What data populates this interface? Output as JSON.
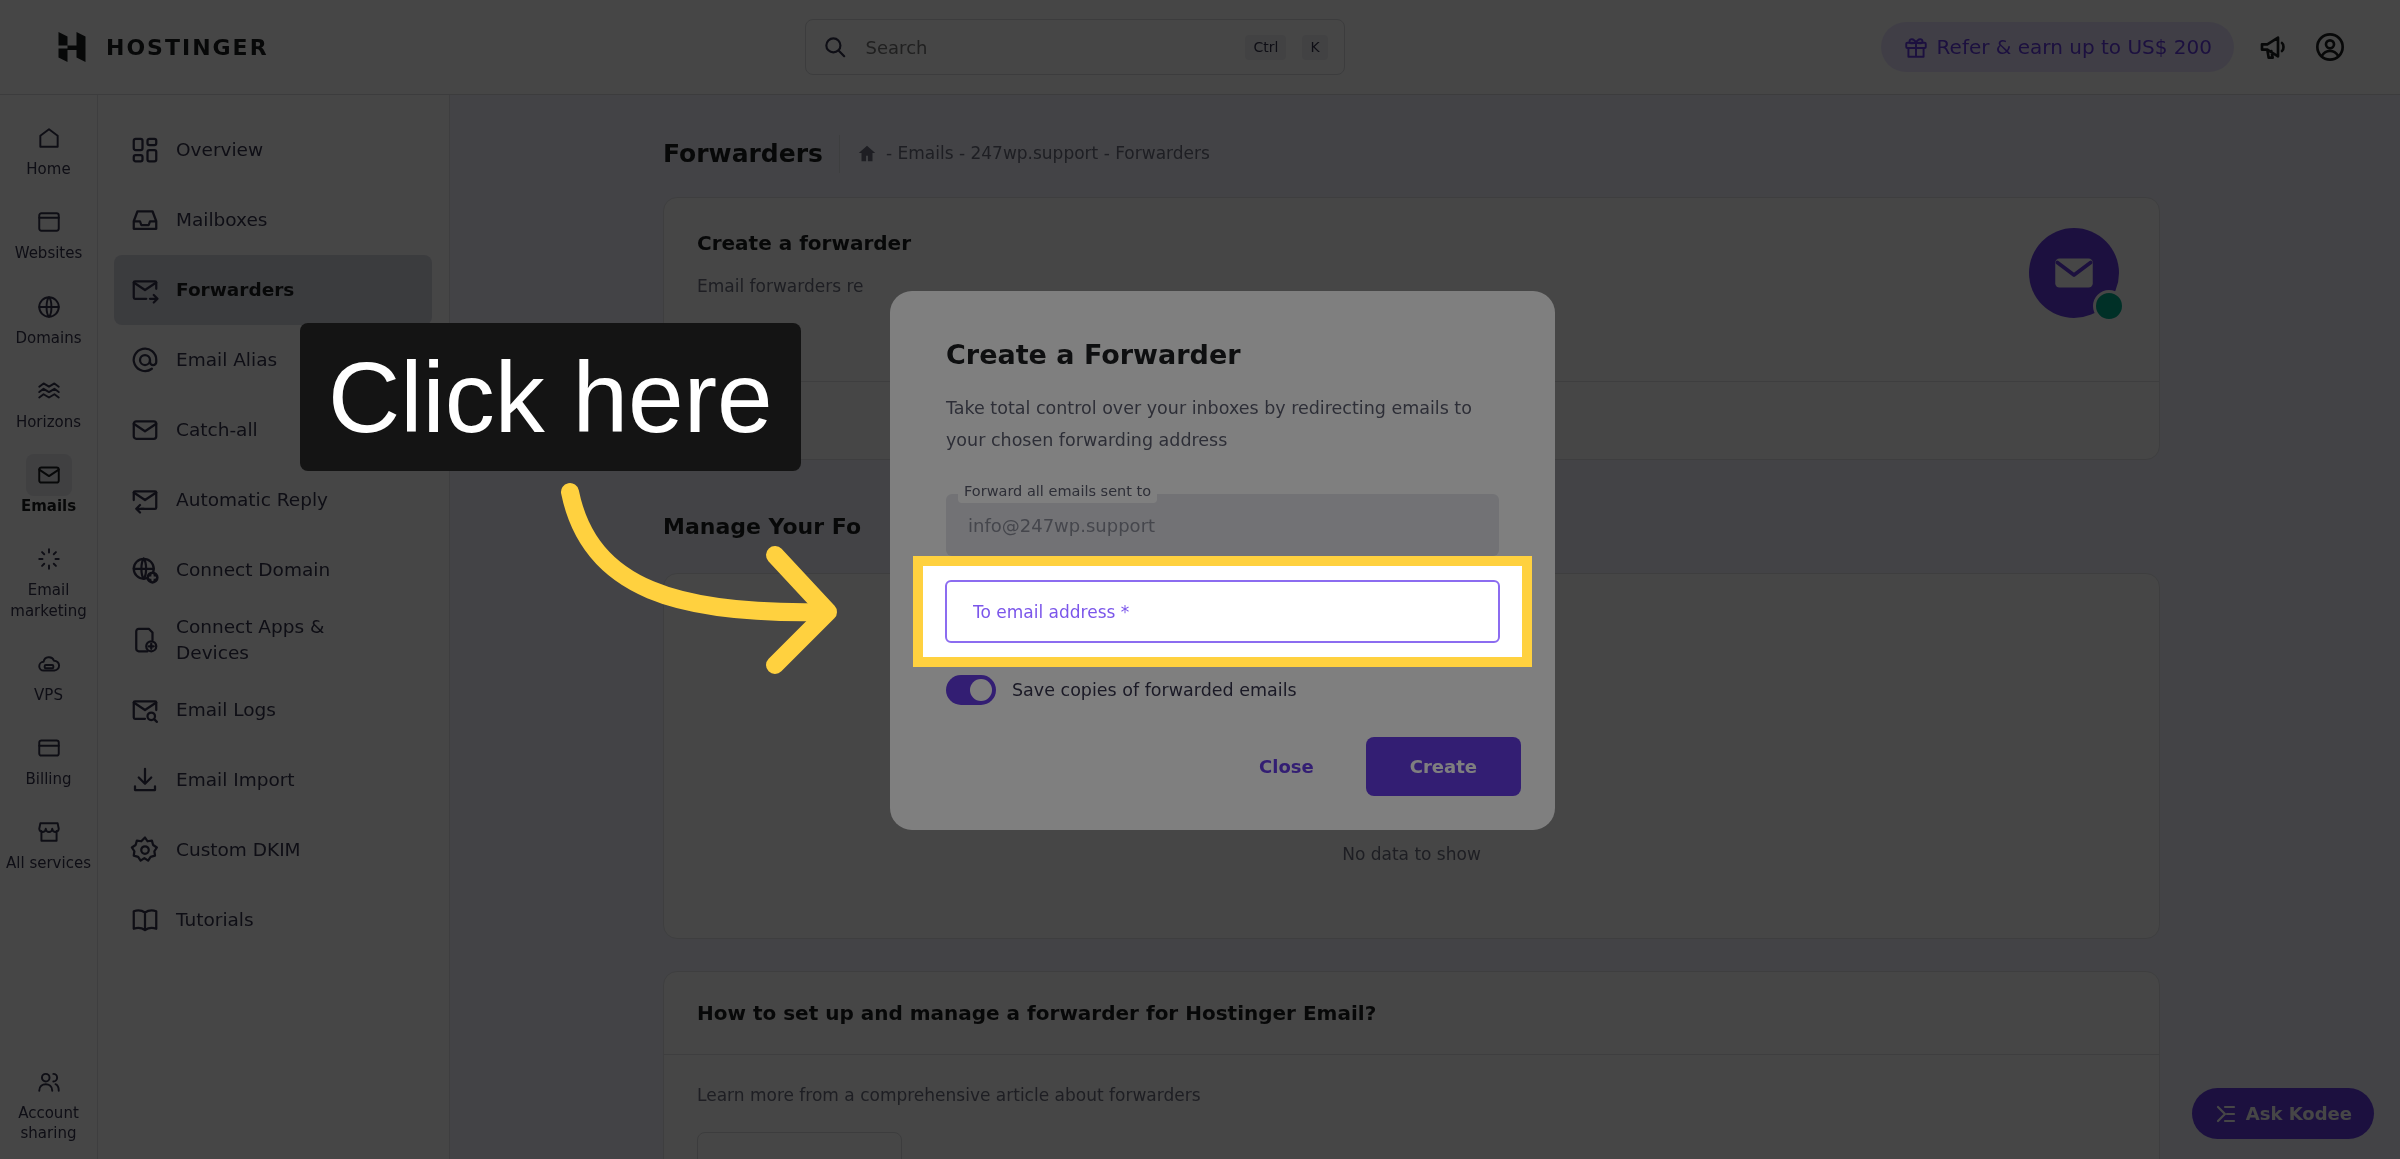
{
  "topbar": {
    "logo": "HOSTINGER",
    "search": {
      "placeholder": "Search",
      "shortcut_keys": [
        "Ctrl",
        "K"
      ]
    },
    "refer_button": "Refer & earn up to US$ 200"
  },
  "rail": {
    "items": [
      {
        "label": "Home",
        "selected": false
      },
      {
        "label": "Websites",
        "selected": false
      },
      {
        "label": "Domains",
        "selected": false
      },
      {
        "label": "Horizons",
        "selected": false
      },
      {
        "label": "Emails",
        "selected": true
      },
      {
        "label": "Email marketing",
        "selected": false
      },
      {
        "label": "VPS",
        "selected": false
      },
      {
        "label": "Billing",
        "selected": false
      },
      {
        "label": "All services",
        "selected": false
      }
    ],
    "bottom_item": {
      "label": "Account sharing",
      "selected": false
    }
  },
  "submenu": {
    "items": [
      {
        "label": "Overview",
        "selected": false
      },
      {
        "label": "Mailboxes",
        "selected": false
      },
      {
        "label": "Forwarders",
        "selected": true
      },
      {
        "label": "Email Alias",
        "selected": false
      },
      {
        "label": "Catch-all",
        "selected": false
      },
      {
        "label": "Automatic Reply",
        "selected": false
      },
      {
        "label": "Connect Domain",
        "selected": false
      },
      {
        "label": "Connect Apps & Devices",
        "selected": false
      },
      {
        "label": "Email Logs",
        "selected": false
      },
      {
        "label": "Email Import",
        "selected": false
      },
      {
        "label": "Custom DKIM",
        "selected": false
      },
      {
        "label": "Tutorials",
        "selected": false
      }
    ]
  },
  "page": {
    "title": "Forwarders",
    "breadcrumb": "- Emails - 247wp.support - Forwarders"
  },
  "create_card": {
    "title": "Create a forwarder",
    "description": "Email forwarders re"
  },
  "manage_section": {
    "title": "Manage Your Fo",
    "empty_text": "No data to show"
  },
  "help_card": {
    "title": "How to set up and manage a forwarder for Hostinger Email?",
    "text": "Learn more from a comprehensive article about forwarders"
  },
  "modal": {
    "title": "Create a Forwarder",
    "description": "Take total control over your inboxes by redirecting emails to your chosen forwarding address",
    "source_field": {
      "label": "Forward all emails sent to",
      "value": "info@247wp.support",
      "disabled": true
    },
    "target_field": {
      "placeholder": "To email address *",
      "highlighted": true
    },
    "toggle": {
      "label": "Save copies of forwarded emails",
      "on": true
    },
    "buttons": [
      {
        "label": "Close",
        "kind": "text"
      },
      {
        "label": "Create",
        "kind": "primary"
      }
    ]
  },
  "callout": {
    "text": "Click here"
  },
  "assistant_button": "Ask Kodee"
}
